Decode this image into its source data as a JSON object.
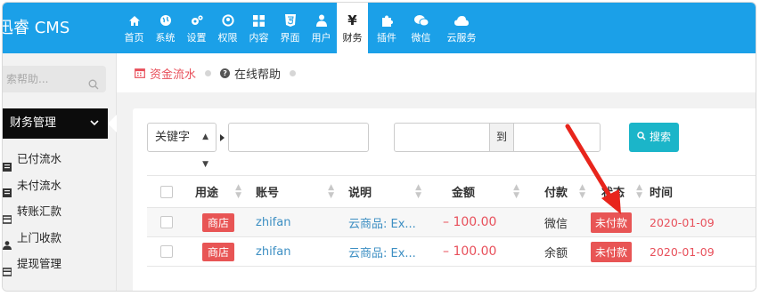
{
  "brand": {
    "name": "迅睿 CMS"
  },
  "nav": [
    {
      "key": "home",
      "label": "首页",
      "icon": "home-icon"
    },
    {
      "key": "system",
      "label": "系统",
      "icon": "globe-icon"
    },
    {
      "key": "settings",
      "label": "设置",
      "icon": "cogs-icon"
    },
    {
      "key": "permission",
      "label": "权限",
      "icon": "user-circle-icon"
    },
    {
      "key": "content",
      "label": "内容",
      "icon": "grid-icon"
    },
    {
      "key": "interface",
      "label": "界面",
      "icon": "html5-icon"
    },
    {
      "key": "users",
      "label": "用户",
      "icon": "user-icon"
    },
    {
      "key": "finance",
      "label": "财务",
      "icon": "yen-icon",
      "active": true
    },
    {
      "key": "plugins",
      "label": "插件",
      "icon": "puzzle-icon"
    },
    {
      "key": "wechat",
      "label": "微信",
      "icon": "wechat-icon"
    },
    {
      "key": "cloud",
      "label": "云服务",
      "icon": "cloud-icon"
    }
  ],
  "sidebar": {
    "search_placeholder": "索帮助...",
    "group_label": "财务管理",
    "items": [
      {
        "label": "已付流水",
        "icon": "list-icon"
      },
      {
        "label": "未付流水",
        "icon": "list-icon"
      },
      {
        "label": "转账汇款",
        "icon": "transfer-icon"
      },
      {
        "label": "上门收款",
        "icon": "person-icon"
      },
      {
        "label": "提现管理",
        "icon": "withdraw-icon"
      }
    ]
  },
  "breadcrumb": {
    "active_label": "资金流水",
    "help_label": "在线帮助"
  },
  "filter": {
    "field_select": "关键字",
    "date_to_label": "到",
    "search_label": "搜索"
  },
  "table": {
    "headers": {
      "use": "用途",
      "account": "账号",
      "desc": "说明",
      "amount": "金额",
      "pay": "付款",
      "status": "状态",
      "time": "时间"
    },
    "rows": [
      {
        "use": "商店",
        "account": "zhifan",
        "desc": "云商品: Ex...",
        "amount": "– 100.00",
        "pay": "微信",
        "status": "未付款",
        "time": "2020-01-09"
      },
      {
        "use": "商店",
        "account": "zhifan",
        "desc": "云商品: Ex...",
        "amount": "– 100.00",
        "pay": "余额",
        "status": "未付款",
        "time": "2020-01-09"
      }
    ]
  },
  "colors": {
    "topbar": "#1ba0e8",
    "accent_red": "#e8505b",
    "search_button": "#1bb5c9",
    "annotation_arrow": "#e8251c"
  }
}
